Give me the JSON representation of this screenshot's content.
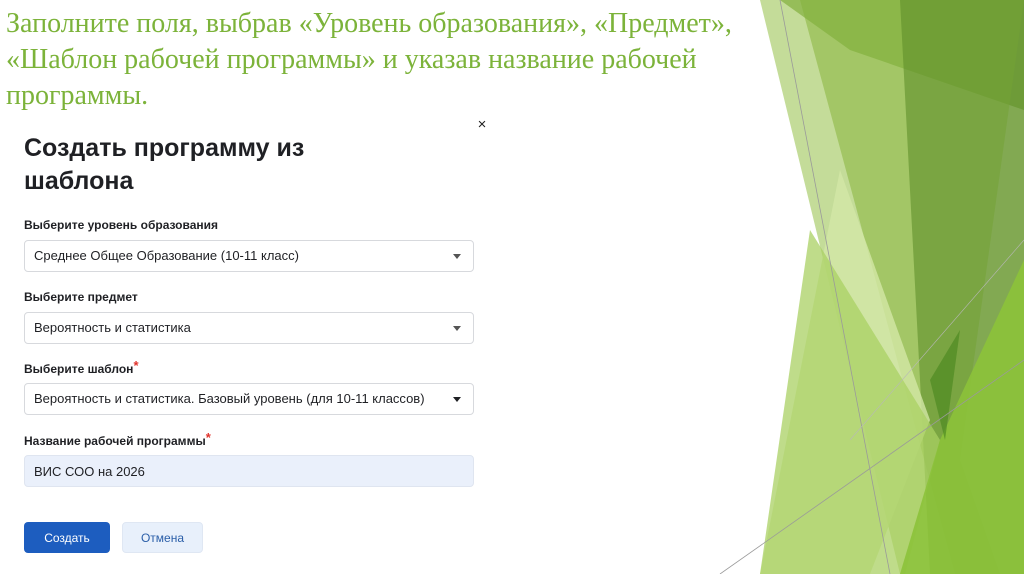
{
  "slide": {
    "title": "Заполните поля, выбрав «Уровень образования», «Предмет», «Шаблон рабочей программы» и указав название рабочей программы."
  },
  "dialog": {
    "title": "Создать программу из шаблона",
    "close_label": "×",
    "fields": {
      "level": {
        "label": "Выберите уровень образования",
        "value": "Среднее Общее Образование (10-11 класс)",
        "required": false
      },
      "subject": {
        "label": "Выберите предмет",
        "value": "Вероятность и статистика",
        "required": false
      },
      "template": {
        "label": "Выберите шаблон",
        "value": "Вероятность и статистика. Базовый уровень (для 10-11 классов)",
        "required": true
      },
      "program_name": {
        "label": "Название рабочей программы",
        "value": "ВИС СОО на 2026",
        "required": true
      }
    },
    "required_mark": "*",
    "buttons": {
      "create": "Создать",
      "cancel": "Отмена"
    }
  },
  "colors": {
    "title_green": "#7cb33a",
    "primary_button": "#1d5dbf",
    "secondary_button": "#e8f0fb",
    "required_star": "#e0322b",
    "input_fill": "#eaf0fb"
  }
}
